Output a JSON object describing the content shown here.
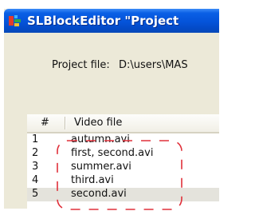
{
  "window": {
    "title": "SLBlockEditor \"Project"
  },
  "project": {
    "label": "Project file:",
    "path": "D:\\users\\MAS"
  },
  "table": {
    "columns": [
      "#",
      "Video file"
    ],
    "rows": [
      {
        "num": "1",
        "file": "autumn.avi"
      },
      {
        "num": "2",
        "file": "first, second.avi"
      },
      {
        "num": "3",
        "file": "summer.avi"
      },
      {
        "num": "4",
        "file": "third.avi"
      },
      {
        "num": "5",
        "file": "second.avi",
        "selected": true
      }
    ]
  },
  "colors": {
    "titlebar": "#0453d9",
    "window_bg": "#ece9d8",
    "dash_highlight": "#e0303a"
  },
  "icons": {
    "app": "blocks-app-icon"
  }
}
